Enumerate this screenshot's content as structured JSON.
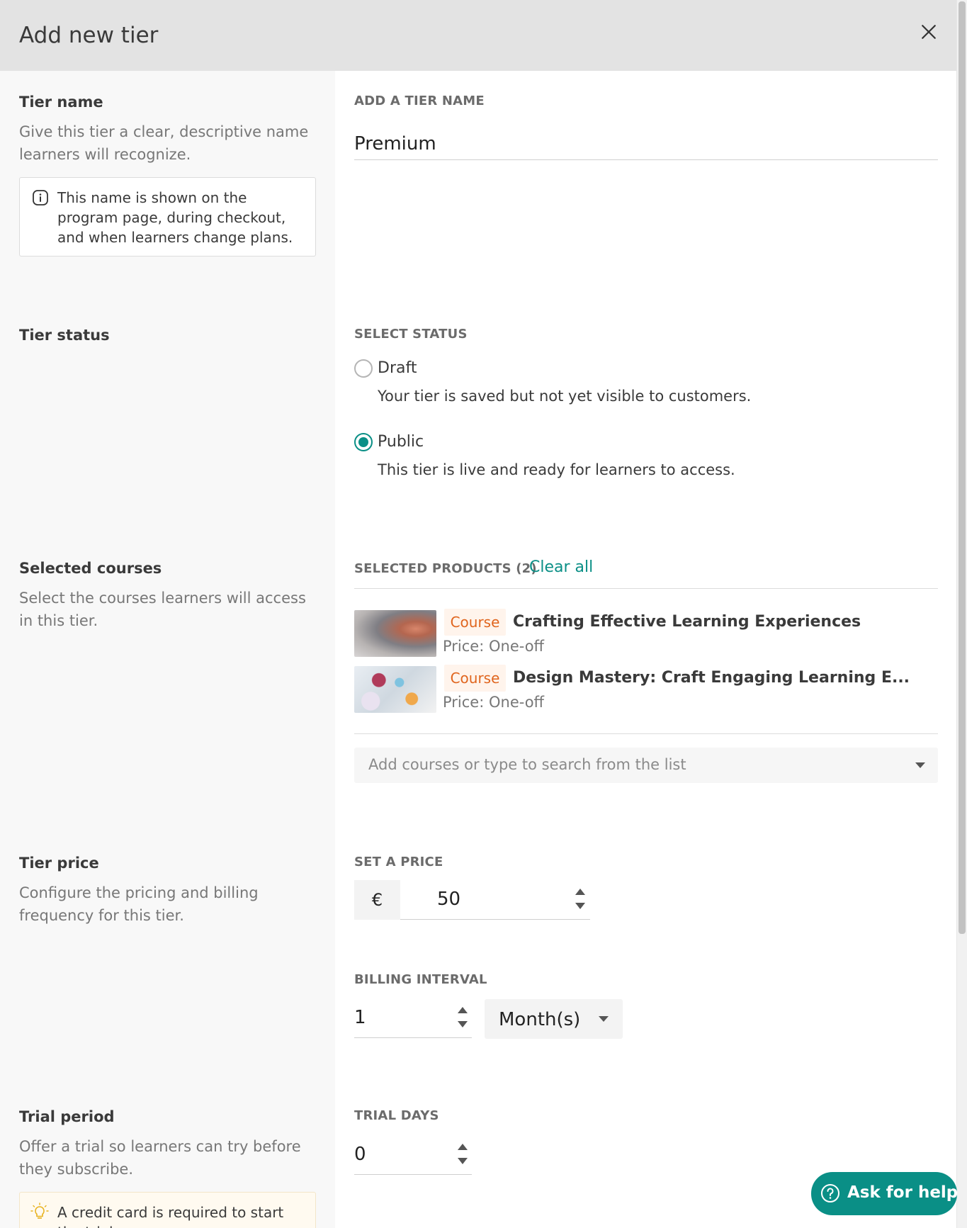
{
  "header": {
    "title": "Add new tier"
  },
  "tier_name": {
    "title": "Tier name",
    "description": "Give this tier a clear, descriptive name learners will recognize.",
    "info": "This name is shown on the program page, during checkout, and when learners change plans.",
    "field_label": "ADD A TIER NAME",
    "value": "Premium"
  },
  "tier_status": {
    "title": "Tier status",
    "field_label": "SELECT STATUS",
    "options": [
      {
        "label": "Draft",
        "description": "Your tier is saved but not yet visible to customers.",
        "selected": false
      },
      {
        "label": "Public",
        "description": "This tier is live and ready for learners to access.",
        "selected": true
      }
    ]
  },
  "selected_courses": {
    "title": "Selected courses",
    "description": "Select the courses learners will access in this tier.",
    "field_label": "SELECTED PRODUCTS (2)",
    "clear_all": "Clear all",
    "products": [
      {
        "badge": "Course",
        "name": "Crafting Effective Learning Experiences",
        "price": "Price: One-off"
      },
      {
        "badge": "Course",
        "name": "Design Mastery: Craft Engaging Learning E...",
        "price": "Price: One-off"
      }
    ],
    "search_placeholder": "Add courses or type to search from the list"
  },
  "tier_price": {
    "title": "Tier price",
    "description": "Configure the pricing and billing frequency for this tier.",
    "price_label": "SET A PRICE",
    "currency": "€",
    "price": "50",
    "interval_label": "BILLING INTERVAL",
    "interval_count": "1",
    "interval_unit": "Month(s)"
  },
  "trial_period": {
    "title": "Trial period",
    "description": "Offer a trial so learners can try before they subscribe.",
    "warning": "A credit card is required to start the trial",
    "field_label": "TRIAL DAYS",
    "value": "0"
  },
  "help": {
    "label": "Ask for help"
  },
  "colors": {
    "accent": "#0a8f86",
    "badge_text": "#e0651e",
    "badge_bg": "#fff4ec",
    "header_bg": "#e3e3e3"
  }
}
